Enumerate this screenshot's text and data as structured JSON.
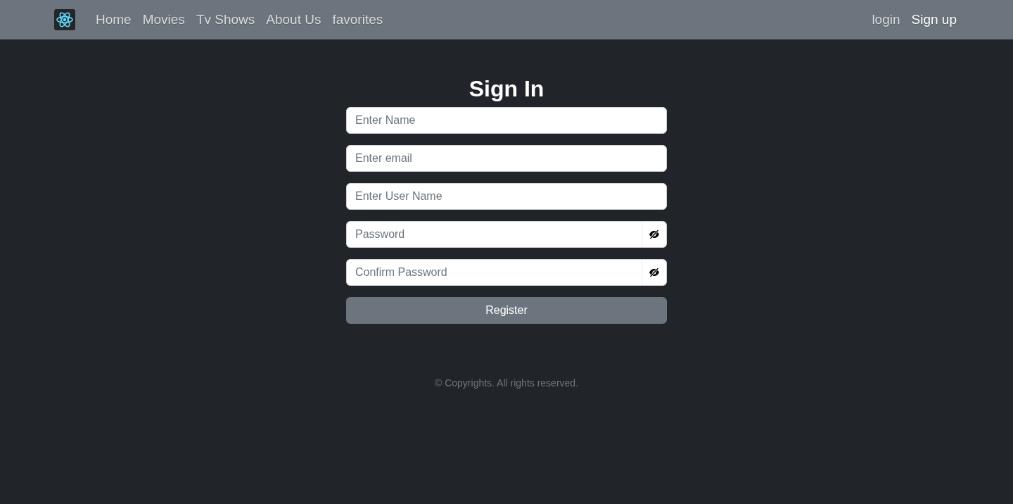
{
  "navbar": {
    "links": [
      {
        "label": "Home",
        "selected": false
      },
      {
        "label": "Movies",
        "selected": false
      },
      {
        "label": "Tv Shows",
        "selected": false
      },
      {
        "label": "About Us",
        "selected": false
      },
      {
        "label": "favorites",
        "selected": false
      }
    ],
    "auth_links": [
      {
        "label": "login",
        "selected": false
      },
      {
        "label": "Sign up",
        "selected": true
      }
    ]
  },
  "form": {
    "title": "Sign In",
    "fields": [
      {
        "kind": "text",
        "placeholder": "Enter Name"
      },
      {
        "kind": "text",
        "placeholder": "Enter email"
      },
      {
        "kind": "text",
        "placeholder": "Enter User Name"
      },
      {
        "kind": "password",
        "placeholder": "Password"
      },
      {
        "kind": "password",
        "placeholder": "Confirm Password"
      }
    ],
    "submit": "Register"
  },
  "footer": {
    "text": "© Copyrights. All rights reserved."
  }
}
